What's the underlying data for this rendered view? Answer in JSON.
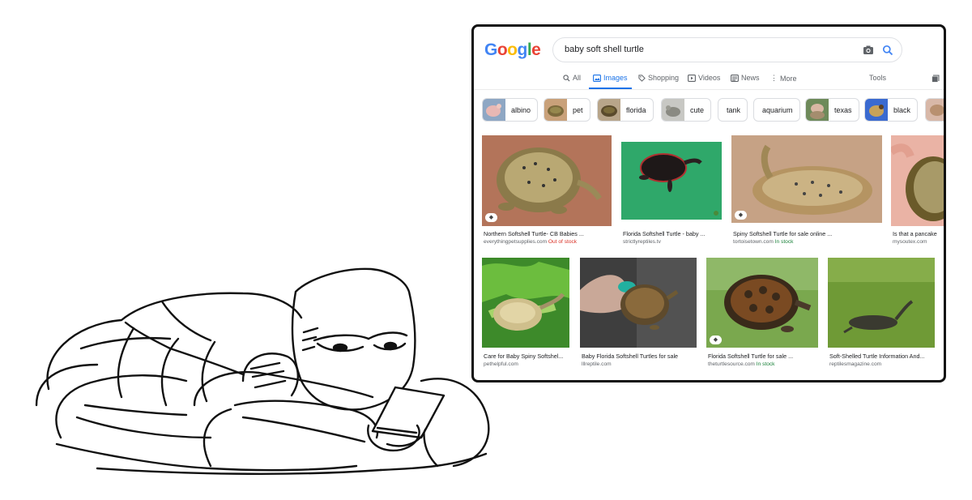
{
  "search": {
    "logo": [
      "G",
      "o",
      "o",
      "g",
      "l",
      "e"
    ],
    "logo_colors": [
      "#4285F4",
      "#EA4335",
      "#FBBC05",
      "#4285F4",
      "#34A853",
      "#EA4335"
    ],
    "query": "baby soft shell turtle"
  },
  "tabs": {
    "all": "All",
    "images": "Images",
    "shopping": "Shopping",
    "videos": "Videos",
    "news": "News",
    "more": "More",
    "tools": "Tools"
  },
  "chips": [
    "albino",
    "pet",
    "florida",
    "cute",
    "tank",
    "aquarium",
    "texas",
    "black"
  ],
  "results": [
    {
      "title": "Northern Softshell Turtle- CB Babies ...",
      "source": "everythingpetsupplies.com",
      "stock": "Out of stock"
    },
    {
      "title": "Florida Softshell Turtle - baby ...",
      "source": "strictlyreptiles.tv",
      "stock": ""
    },
    {
      "title": "Spiny Softshell Turtle for sale online ...",
      "source": "tortoisetown.com",
      "stock": "In stock"
    },
    {
      "title": "Is that a pancake",
      "source": "mysoutex.com",
      "stock": ""
    },
    {
      "title": "Care for Baby Spiny Softshel...",
      "source": "pethelpful.com",
      "stock": ""
    },
    {
      "title": "Baby Florida Softshell Turtles for sale",
      "source": "lllreptile.com",
      "stock": ""
    },
    {
      "title": "Florida Softshell Turtle for sale ...",
      "source": "theturtlesource.com",
      "stock": "In stock"
    },
    {
      "title": "Soft-Shelled Turtle Information And...",
      "source": "reptilesmagazine.com",
      "stock": ""
    }
  ],
  "colors": {
    "accent": "#1a73e8",
    "in_stock": "#188038",
    "out_of_stock": "#d93025"
  }
}
